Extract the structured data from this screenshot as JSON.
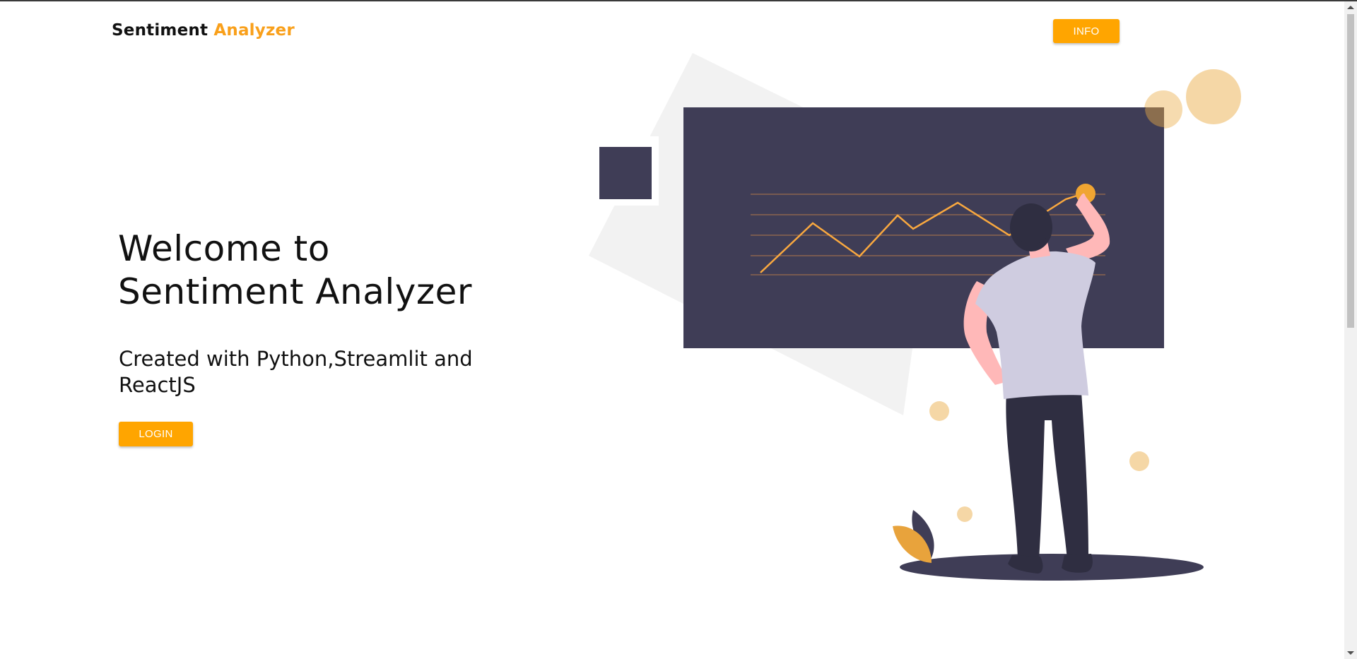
{
  "header": {
    "brand_primary": "Sentiment",
    "brand_accent": "Analyzer",
    "info_label": "INFO"
  },
  "hero": {
    "title_line1": "Welcome to",
    "title_line2": "Sentiment Analyzer",
    "subtitle": "Created with Python,Streamlit and ReactJS",
    "login_label": "LOGIN"
  },
  "colors": {
    "accent": "#ffa500",
    "brand_accent": "#f9a01b",
    "board": "#3f3d56",
    "chart_line": "#f9a83f"
  },
  "illustration": {
    "name": "person analyzing chart illustration"
  }
}
